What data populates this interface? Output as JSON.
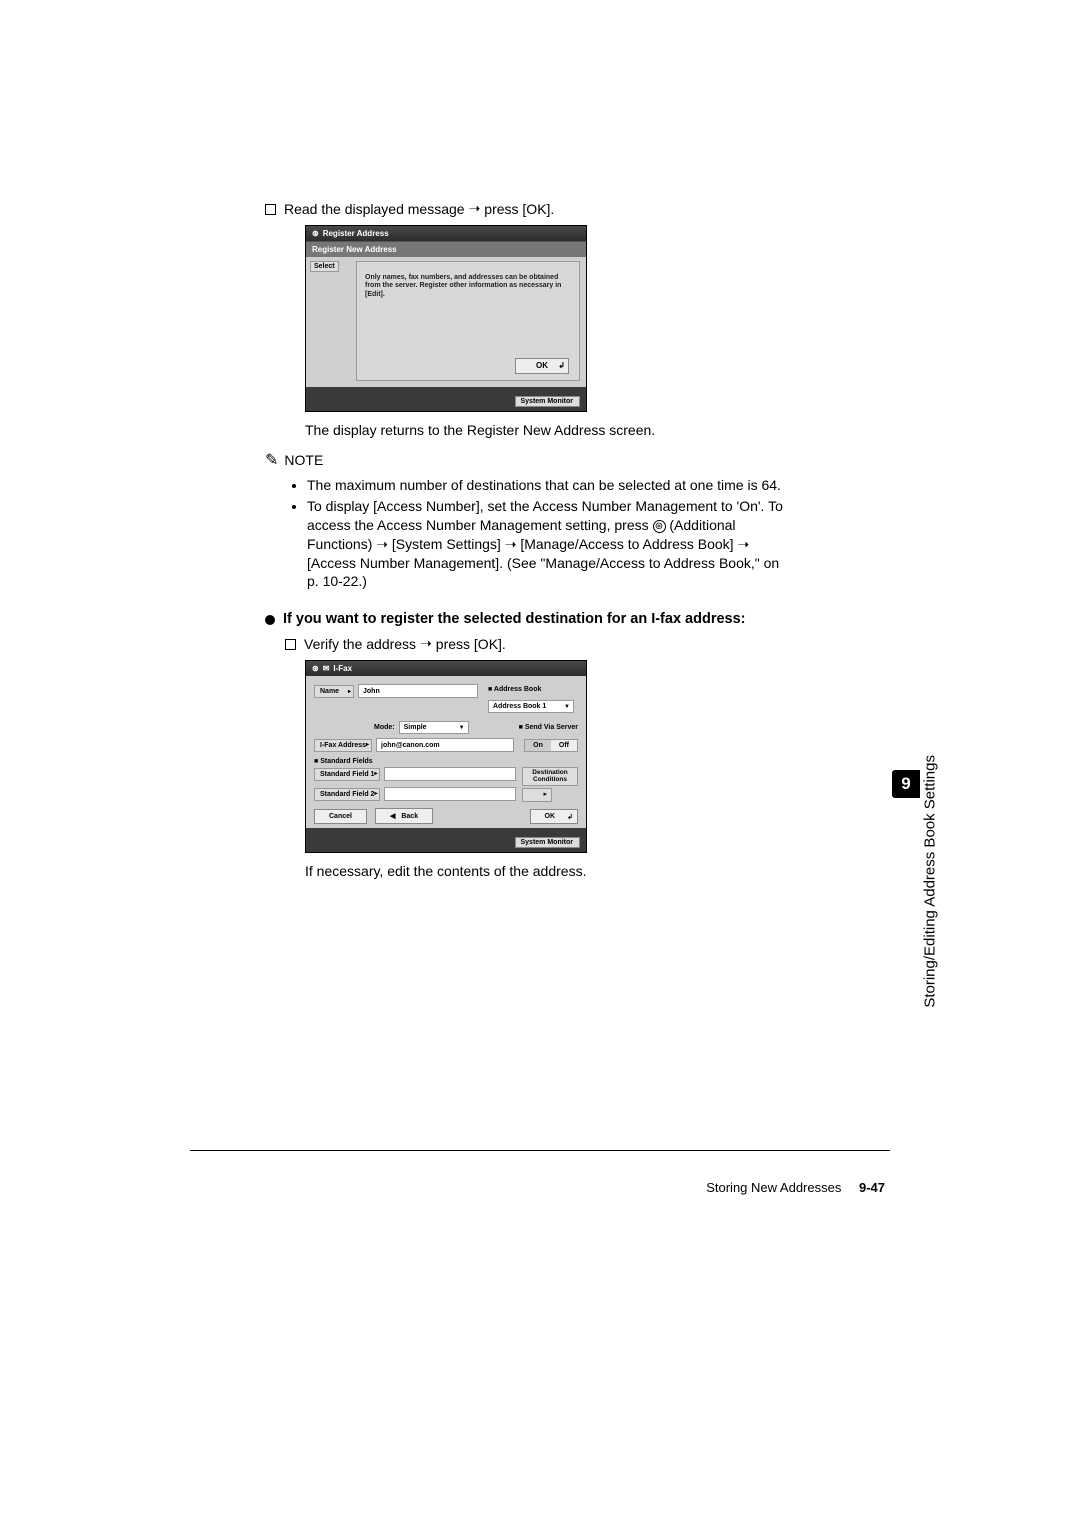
{
  "step1": {
    "prefix": "Read the displayed message",
    "suffix": "press [OK]."
  },
  "screenshot1": {
    "title": "Register Address",
    "subtitle": "Register New Address",
    "select": "Select",
    "message": "Only names, fax numbers, and addresses can be obtained from the server. Register other information as necessary in [Edit].",
    "ok": "OK",
    "sysmon": "System Monitor"
  },
  "returnText": "The display returns to the Register New Address screen.",
  "noteLabel": "NOTE",
  "notes": {
    "n1": "The maximum number of destinations that can be selected at one time is 64.",
    "n2a": "To display [Access Number], set the Access Number Management to 'On'. To access the Access Number Management setting, press ",
    "n2b": " (Additional Functions) ",
    "n2c": " [System Settings] ",
    "n2d": " [Manage/Access to Address Book] ",
    "n2e": " [Access Number Management]. (See \"Manage/Access to Address Book,\" on p. 10-22.)"
  },
  "sectionTitle": "If you want to register the selected destination for an I-fax address:",
  "step2": {
    "prefix": "Verify the address",
    "suffix": "press [OK]."
  },
  "screenshot2": {
    "title": "I-Fax",
    "nameLabel": "Name",
    "nameValue": "John",
    "addrBookHead": "Address Book",
    "addrBookValue": "Address Book 1",
    "modeLabel": "Mode:",
    "modeValue": "Simple",
    "sendViaServer": "Send Via Server",
    "ifaxLabel": "I-Fax Address",
    "ifaxValue": "john@canon.com",
    "on": "On",
    "off": "Off",
    "stdFieldsHead": "Standard Fields",
    "std1": "Standard Field 1",
    "std2": "Standard Field 2",
    "destCond": "Destination Conditions",
    "cancel": "Cancel",
    "back": "Back",
    "ok": "OK",
    "sysmon": "System Monitor"
  },
  "afterText": "If necessary, edit the contents of the address.",
  "footer": {
    "section": "Storing New Addresses",
    "page": "9-47"
  },
  "sideTab": "9",
  "sideText": "Storing/Editing Address Book Settings"
}
